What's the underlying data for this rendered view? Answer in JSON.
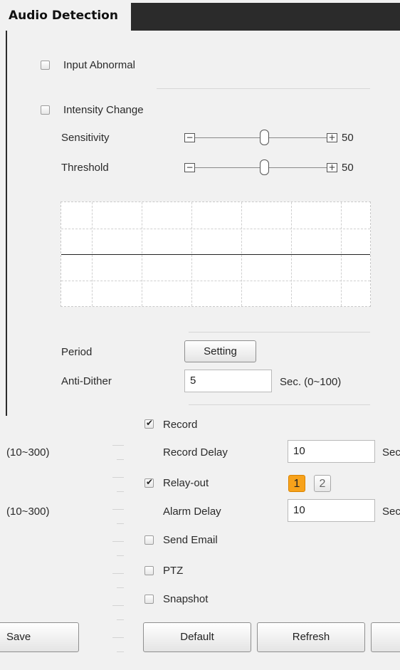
{
  "header": {
    "title": "Audio Detection"
  },
  "input_abnormal": {
    "label": "Input Abnormal",
    "checked": false
  },
  "intensity_change": {
    "label": "Intensity Change",
    "checked": false
  },
  "sensitivity": {
    "label": "Sensitivity",
    "value": "50",
    "minus": "−",
    "plus": "+"
  },
  "threshold": {
    "label": "Threshold",
    "value": "50",
    "minus": "−",
    "plus": "+"
  },
  "period": {
    "label": "Period",
    "button": "Setting"
  },
  "anti_dither": {
    "label": "Anti-Dither",
    "value": "5",
    "unit": "Sec. (0~100)"
  },
  "record": {
    "label": "Record",
    "checked": true
  },
  "record_delay": {
    "label": "Record Delay",
    "value": "10",
    "range": "(10~300)",
    "unit": "Sec"
  },
  "relay_out": {
    "label": "Relay-out",
    "checked": true,
    "buttons": [
      "1",
      "2"
    ]
  },
  "alarm_delay": {
    "label": "Alarm Delay",
    "value": "10",
    "range": "(10~300)",
    "unit": "Sec"
  },
  "send_email": {
    "label": "Send Email",
    "checked": false
  },
  "ptz": {
    "label": "PTZ",
    "checked": false
  },
  "snapshot": {
    "label": "Snapshot",
    "checked": false
  },
  "footer": {
    "save": "Save",
    "default": "Default",
    "refresh": "Refresh"
  },
  "colors": {
    "accent": "#f7a21b",
    "tab_bar": "#2b2b2b",
    "background": "#f1f1f1"
  }
}
